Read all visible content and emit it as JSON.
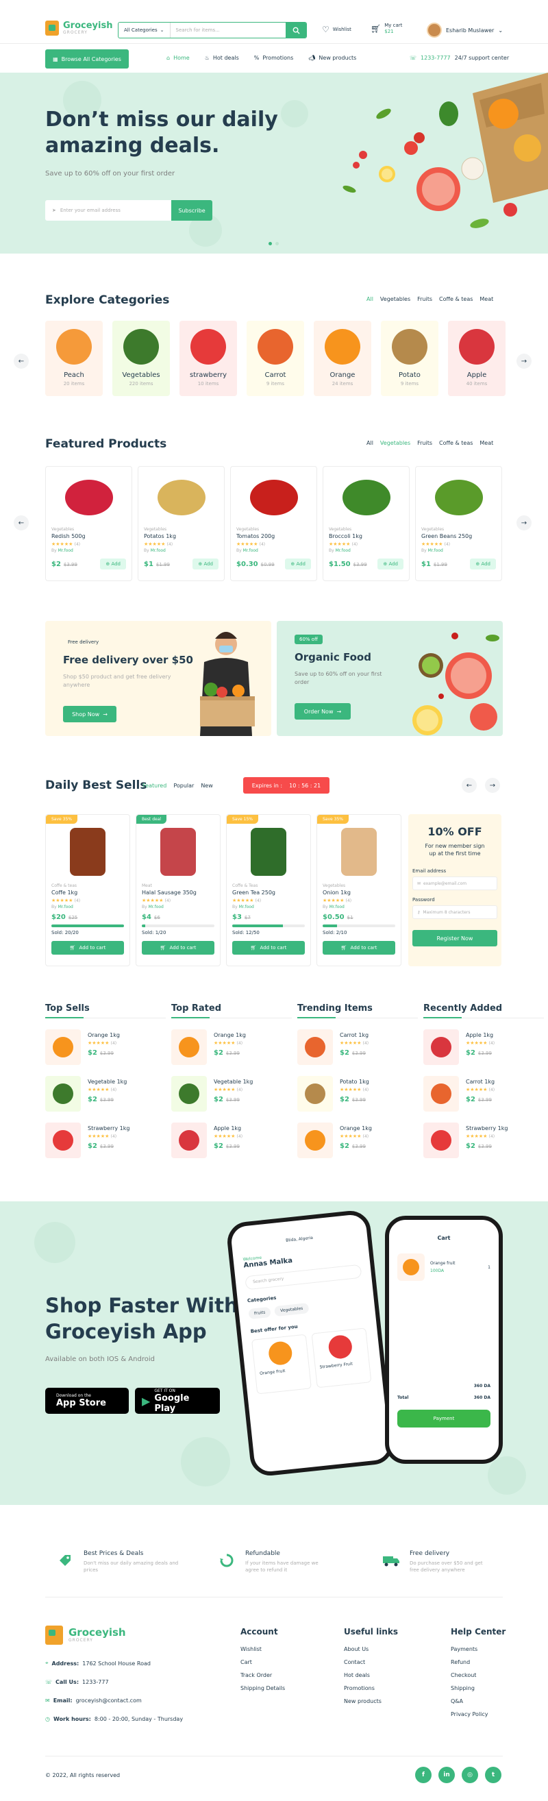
{
  "colors": {
    "primary": "#3bb77e",
    "dark": "#253d4e",
    "mint": "#d8f1e5",
    "sale": "#f74b4b",
    "hot": "#fdc040"
  },
  "header": {
    "brand": "Groceyish",
    "brand_sub": "GROCERY",
    "search": {
      "category": "All Categories",
      "placeholder": "Search for items..."
    },
    "wishlist": "Wishlist",
    "cart_label": "My cart",
    "cart_total": "$21",
    "user": "Esharib Muslawer"
  },
  "nav": {
    "browse": "Browse All Categories",
    "links": [
      {
        "icon": "home-icon",
        "label": "Home"
      },
      {
        "icon": "fire-icon",
        "label": "Hot deals"
      },
      {
        "icon": "percent-icon",
        "label": "Promotions"
      },
      {
        "icon": "megaphone-icon",
        "label": "New products"
      }
    ],
    "phone": "1233-7777",
    "support": "24/7 support center"
  },
  "hero": {
    "title": "Don’t miss our daily amazing deals.",
    "subtitle": "Save up to 60% off on your first order",
    "email_placeholder": "Enter your email address",
    "subscribe": "Subscribe"
  },
  "categories": {
    "title": "Explore Categories",
    "tabs": [
      "All",
      "Vegetables",
      "Fruits",
      "Coffe & teas",
      "Meat"
    ],
    "items": [
      {
        "name": "Peach",
        "count": "20 items",
        "bg": "#fff3eb",
        "color": "#f59a3a"
      },
      {
        "name": "Vegetables",
        "count": "220 items",
        "bg": "#f2fce4",
        "color": "#3d7a2c"
      },
      {
        "name": "strawberry",
        "count": "10 items",
        "bg": "#feeceb",
        "color": "#e63a3a"
      },
      {
        "name": "Carrot",
        "count": "9 items",
        "bg": "#fffceb",
        "color": "#e8652e"
      },
      {
        "name": "Orange",
        "count": "24 items",
        "bg": "#fff3eb",
        "color": "#f7941d"
      },
      {
        "name": "Potato",
        "count": "9 items",
        "bg": "#fffceb",
        "color": "#b58a4c"
      },
      {
        "name": "Apple",
        "count": "40 items",
        "bg": "#feeceb",
        "color": "#d9363e"
      }
    ]
  },
  "featured": {
    "title": "Featured Products",
    "tabs": [
      "All",
      "Vegetables",
      "Fruits",
      "Coffe & teas",
      "Meat"
    ],
    "add": "Add",
    "items": [
      {
        "cat": "Vegetables",
        "name": "Redish 500g",
        "count": "(4)",
        "by": "By",
        "brand": "Mr.food",
        "price": "$2",
        "old": "$3.99",
        "color": "#d1223d"
      },
      {
        "cat": "Vegetables",
        "name": "Potatos 1kg",
        "count": "(4)",
        "by": "By",
        "brand": "Mr.food",
        "price": "$1",
        "old": "$1.99",
        "color": "#d9b45c"
      },
      {
        "cat": "Vegetables",
        "name": "Tomatos 200g",
        "count": "(4)",
        "by": "By",
        "brand": "Mr.food",
        "price": "$0.30",
        "old": "$0.99",
        "color": "#c8201c"
      },
      {
        "cat": "Vegetables",
        "name": "Broccoli 1kg",
        "count": "(4)",
        "by": "By",
        "brand": "Mr.food",
        "price": "$1.50",
        "old": "$3.99",
        "color": "#3f8a2a"
      },
      {
        "cat": "Vegetables",
        "name": "Green Beans 250g",
        "count": "(4)",
        "by": "By",
        "brand": "Mr.food",
        "price": "$1",
        "old": "$1.99",
        "color": "#5a9b2a"
      }
    ]
  },
  "banners": [
    {
      "tag": "Free delivery",
      "title": "Free delivery over $50",
      "desc": "Shop $50 product and get free delivery anywhere",
      "cta": "Shop Now"
    },
    {
      "tag": "60% off",
      "title": "Organic Food",
      "desc": "Save up to 60% off on your first order",
      "cta": "Order Now"
    }
  ],
  "daily": {
    "title": "Daily Best Sells",
    "tabs": [
      "Featured",
      "Popular",
      "New"
    ],
    "expires_label": "Expires in :",
    "timer": "10 : 56 : 21",
    "add_to_cart": "Add to cart",
    "items": [
      {
        "tag": "Save 35%",
        "tagcolor": "#fdc040",
        "cat": "Coffe & teas",
        "name": "Coffe 1kg",
        "count": "(4)",
        "by": "By",
        "brand": "Mr.food",
        "price": "$20",
        "old": "$25",
        "sold": "Sold: 20/20",
        "pct": 1.0,
        "color": "#8a3b1c"
      },
      {
        "tag": "Best deal",
        "tagcolor": "#3bb77e",
        "cat": "Meat",
        "name": "Halal Sausage 350g",
        "count": "(4)",
        "by": "By",
        "brand": "Mr.food",
        "price": "$4",
        "old": "$6",
        "sold": "Sold: 1/20",
        "pct": 0.05,
        "color": "#c5454a"
      },
      {
        "tag": "Save 15%",
        "tagcolor": "#fdc040",
        "cat": "Coffe & Teas",
        "name": "Green Tea 250g",
        "count": "(4)",
        "by": "By",
        "brand": "Mr.food",
        "price": "$3",
        "old": "$7",
        "sold": "Sold: 12/50",
        "pct": 0.7,
        "color": "#2f6d2a"
      },
      {
        "tag": "Save 35%",
        "tagcolor": "#fdc040",
        "cat": "Vegetables",
        "name": "Onion 1kg",
        "count": "(4)",
        "by": "By",
        "brand": "Mr.food",
        "price": "$0.50",
        "old": "$1",
        "sold": "Sold: 2/10",
        "pct": 0.2,
        "color": "#e2b98a"
      }
    ],
    "promo": {
      "title": "10% OFF",
      "desc": "For new member sign up at the first time",
      "email_label": "Email address",
      "email_placeholder": "example@email.com",
      "password_label": "Password",
      "password_placeholder": "Maximum 8 characters",
      "register": "Register Now"
    }
  },
  "lists": [
    {
      "title": "Top Sells",
      "items": [
        {
          "name": "Orange 1kg",
          "count": "(4)",
          "price": "$2",
          "old": "$3.99",
          "bg": "#fff3eb",
          "color": "#f7941d"
        },
        {
          "name": "Vegetable 1kg",
          "count": "(4)",
          "price": "$2",
          "old": "$3.99",
          "bg": "#f2fce4",
          "color": "#3d7a2c"
        },
        {
          "name": "Strawberry 1kg",
          "count": "(4)",
          "price": "$2",
          "old": "$3.99",
          "bg": "#feeceb",
          "color": "#e63a3a"
        }
      ]
    },
    {
      "title": "Top Rated",
      "items": [
        {
          "name": "Orange 1kg",
          "count": "(4)",
          "price": "$2",
          "old": "$3.99",
          "bg": "#fff3eb",
          "color": "#f7941d"
        },
        {
          "name": "Vegetable 1kg",
          "count": "(4)",
          "price": "$2",
          "old": "$3.99",
          "bg": "#f2fce4",
          "color": "#3d7a2c"
        },
        {
          "name": "Apple 1kg",
          "count": "(4)",
          "price": "$2",
          "old": "$3.99",
          "bg": "#feeceb",
          "color": "#d9363e"
        }
      ]
    },
    {
      "title": "Trending Items",
      "items": [
        {
          "name": "Carrot 1kg",
          "count": "(4)",
          "price": "$2",
          "old": "$3.99",
          "bg": "#fff3eb",
          "color": "#e8652e"
        },
        {
          "name": "Potato 1kg",
          "count": "(4)",
          "price": "$2",
          "old": "$3.99",
          "bg": "#fffceb",
          "color": "#b58a4c"
        },
        {
          "name": "Orange 1kg",
          "count": "(4)",
          "price": "$2",
          "old": "$3.99",
          "bg": "#fff3eb",
          "color": "#f7941d"
        }
      ]
    },
    {
      "title": "Recently Added",
      "items": [
        {
          "name": "Apple 1kg",
          "count": "(4)",
          "price": "$2",
          "old": "$3.99",
          "bg": "#feeceb",
          "color": "#d9363e"
        },
        {
          "name": "Carrot 1kg",
          "count": "(4)",
          "price": "$2",
          "old": "$3.99",
          "bg": "#fff3eb",
          "color": "#e8652e"
        },
        {
          "name": "Strawberry 1kg",
          "count": "(4)",
          "price": "$2",
          "old": "$3.99",
          "bg": "#feeceb",
          "color": "#e63a3a"
        }
      ]
    }
  ],
  "app": {
    "title": "Shop Faster With Groceyish App",
    "subtitle": "Available on both IOS & Android",
    "appstore_small": "Download on the",
    "appstore": "App Store",
    "play_small": "GET IT ON",
    "play": "Google Play",
    "phone1": {
      "location": "Blida, Algeria",
      "welcome": "Welcome",
      "name": "Annas Malka",
      "search": "Search grocery",
      "categories": "Categories",
      "see_all": "See all",
      "chips": [
        "Fruits",
        "Vegetables"
      ],
      "offer": "Best offer for you",
      "p1": "Orange Fruit",
      "p2": "Strawberry Fruit"
    },
    "phone2": {
      "title": "Cart",
      "item": "Orange fruit",
      "price": "100DA",
      "qty": "1",
      "subtotal": "360 DA",
      "total_label": "Total",
      "total": "360 DA",
      "pay": "Payment"
    }
  },
  "features": [
    {
      "icon": "tag-icon",
      "title": "Best Prices & Deals",
      "desc": "Don't miss our daily amazing deals and prices"
    },
    {
      "icon": "refund-icon",
      "title": "Refundable",
      "desc": "If your items have damage we agree to refund it"
    },
    {
      "icon": "truck-icon",
      "title": "Free delivery",
      "desc": "Do purchase over $50 and get free delivery anywhere"
    }
  ],
  "footer": {
    "brand": "Groceyish",
    "brand_sub": "GROCERY",
    "address_label": "Address:",
    "address": "1762 School House Road",
    "call_label": "Call Us:",
    "call": "1233-777",
    "email_label": "Email:",
    "email": "groceyish@contact.com",
    "hours_label": "Work hours:",
    "hours": "8:00 - 20:00, Sunday - Thursday",
    "columns": [
      {
        "title": "Account",
        "links": [
          "Wishlist",
          "Cart",
          "Track Order",
          "Shipping Details"
        ]
      },
      {
        "title": "Useful links",
        "links": [
          "About Us",
          "Contact",
          "Hot deals",
          "Promotions",
          "New products"
        ]
      },
      {
        "title": "Help Center",
        "links": [
          "Payments",
          "Refund",
          "Checkout",
          "Shipping",
          "Q&A",
          "Privacy Policy"
        ]
      }
    ],
    "copyright": "© 2022, All rights reserved",
    "social": [
      {
        "icon": "facebook-icon",
        "glyph": "f"
      },
      {
        "icon": "linkedin-icon",
        "glyph": "in"
      },
      {
        "icon": "instagram-icon",
        "glyph": "◎"
      },
      {
        "icon": "twitter-icon",
        "glyph": "t"
      }
    ]
  }
}
